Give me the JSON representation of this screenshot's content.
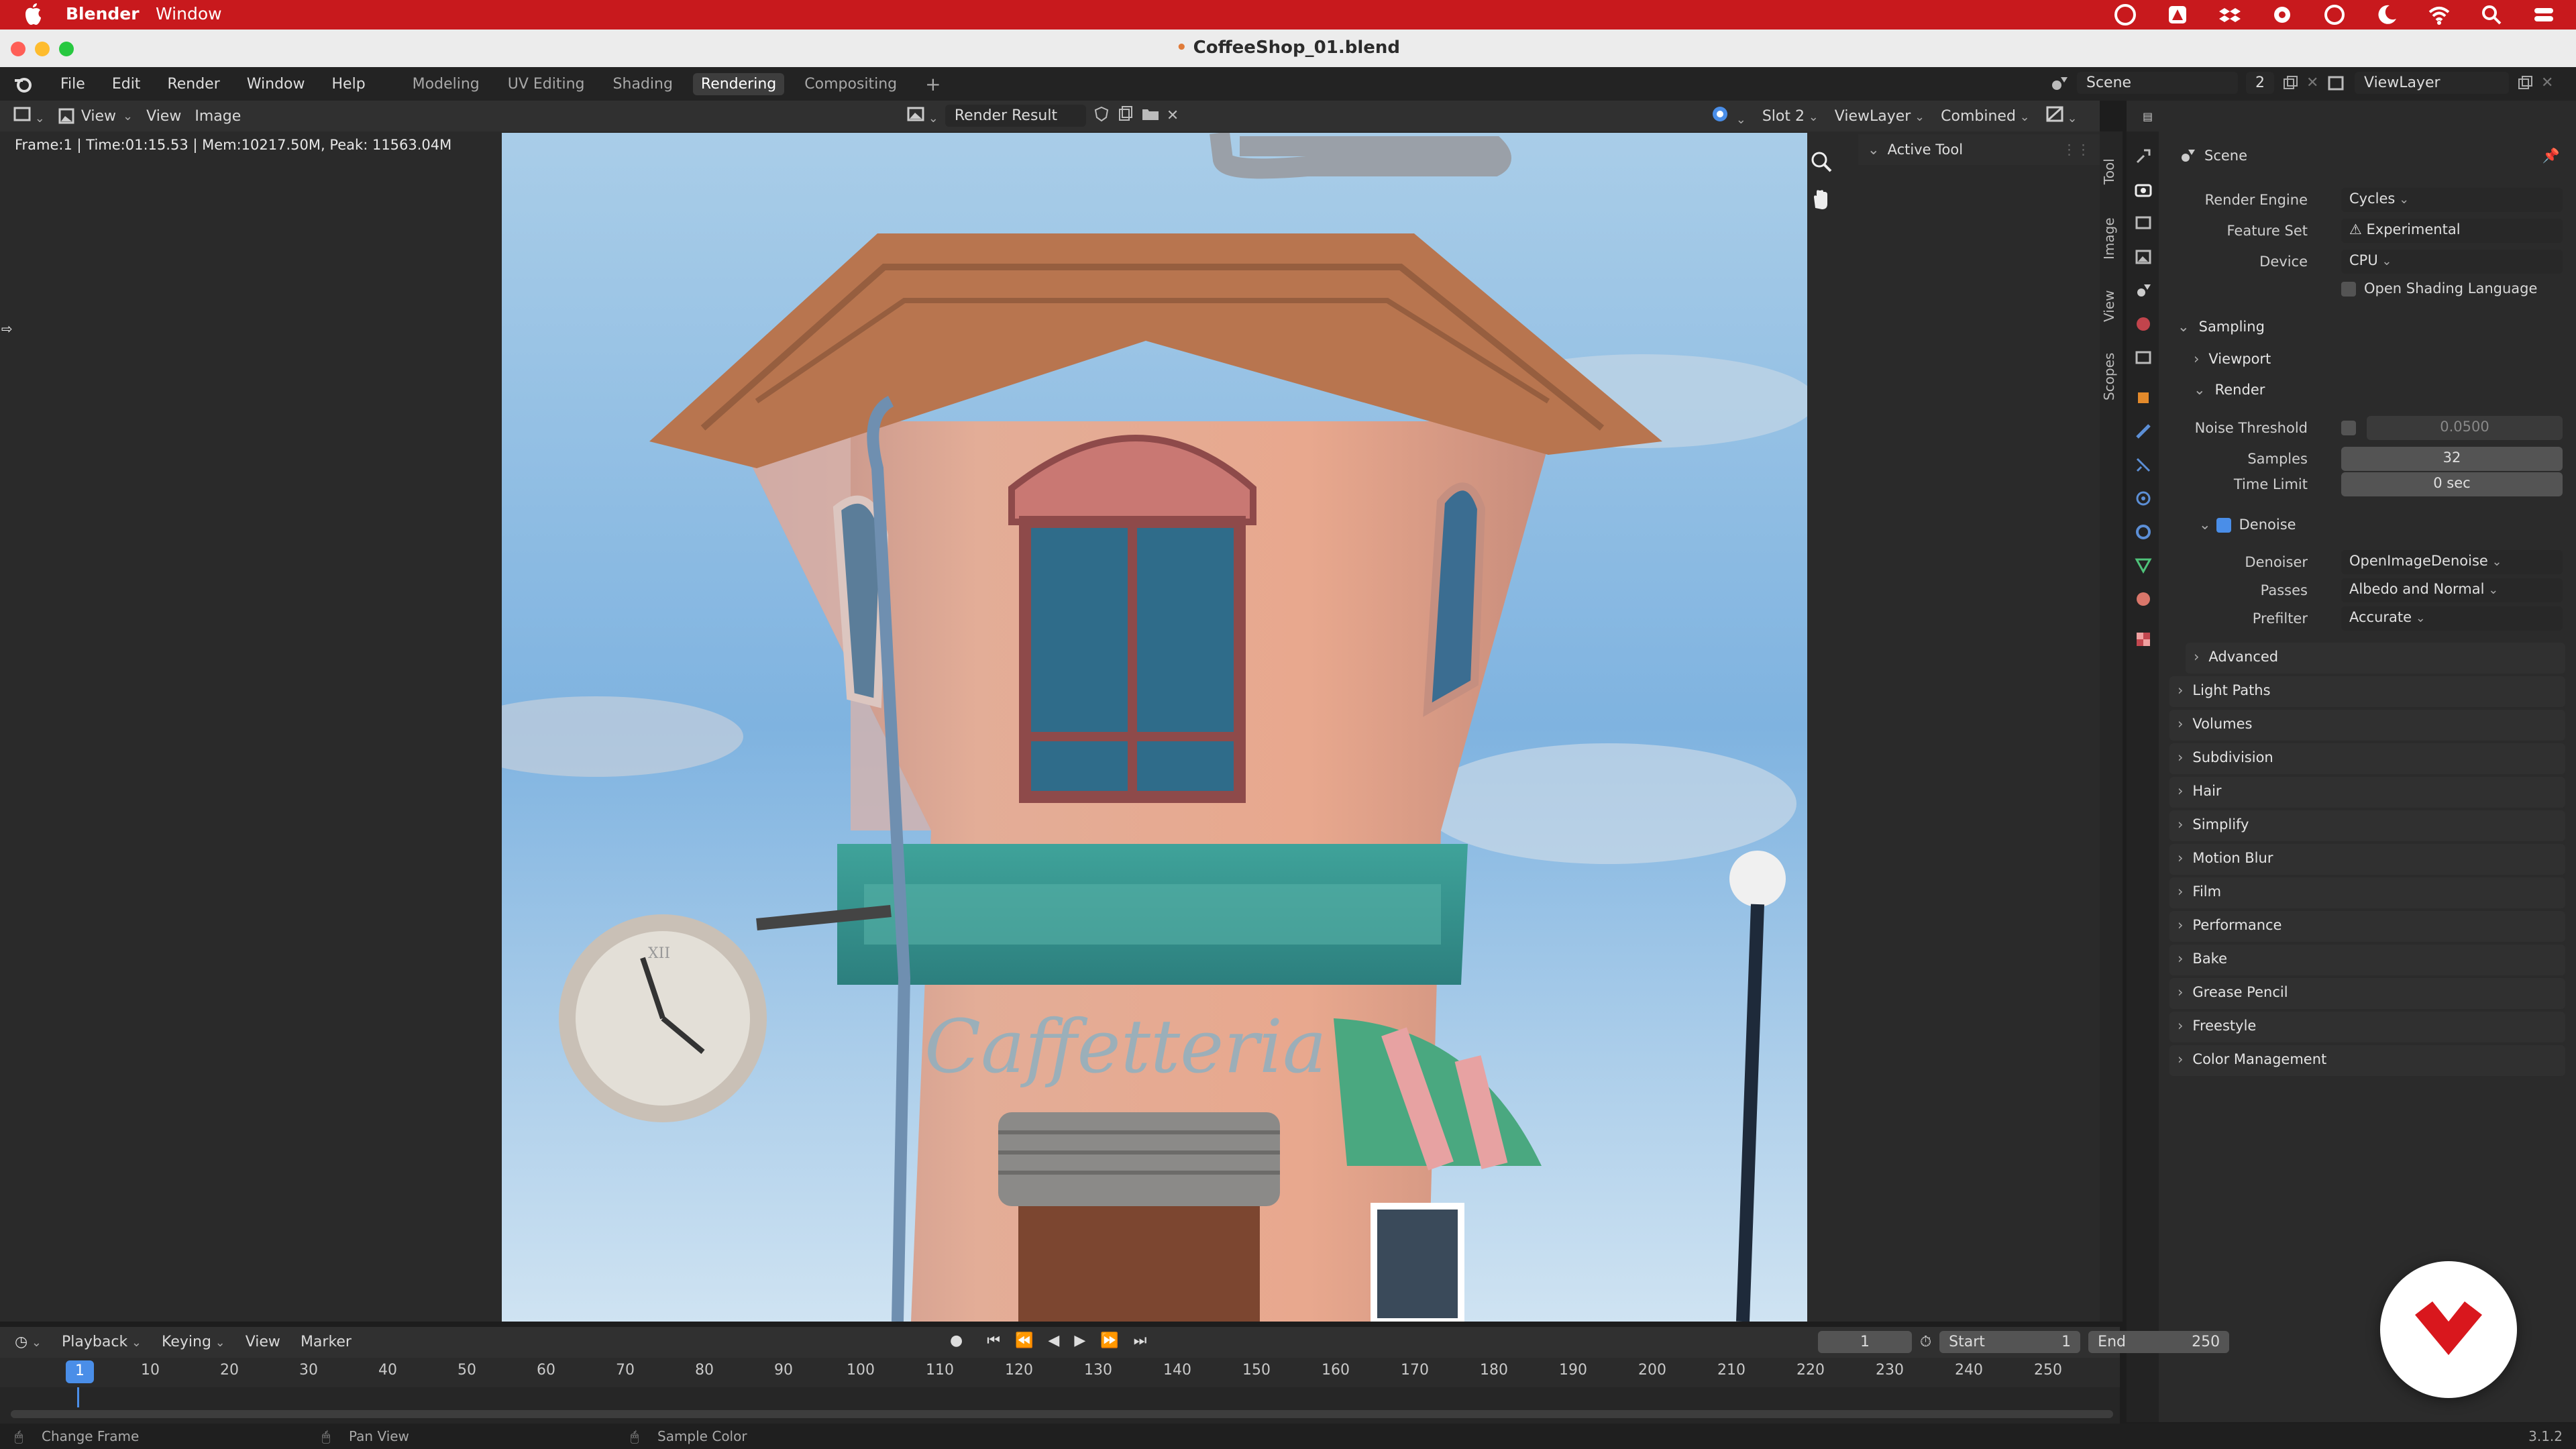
{
  "macos": {
    "app_name": "Blender",
    "menu": [
      "Window"
    ]
  },
  "window": {
    "title": "CoffeeShop_01.blend",
    "modified_dot": "•"
  },
  "blender_menu": [
    "File",
    "Edit",
    "Render",
    "Window",
    "Help"
  ],
  "workspaces": [
    {
      "label": "Modeling",
      "active": false
    },
    {
      "label": "UV Editing",
      "active": false
    },
    {
      "label": "Shading",
      "active": false
    },
    {
      "label": "Rendering",
      "active": true
    },
    {
      "label": "Compositing",
      "active": false
    }
  ],
  "add_workspace": "+",
  "scene": {
    "label": "Scene",
    "users": "2",
    "view_layer": "ViewLayer"
  },
  "image_editor": {
    "menus": [
      "View",
      "View",
      "Image"
    ],
    "image_name": "Render Result",
    "slot": "Slot 2",
    "view_layer": "ViewLayer",
    "pass": "Combined",
    "stats": "Frame:1 | Time:01:15.53 | Mem:10217.50M, Peak: 11563.04M"
  },
  "side_tabs": [
    "Tool",
    "Image",
    "View",
    "Scopes"
  ],
  "active_tool": {
    "label": "Active Tool"
  },
  "properties": {
    "context": "Scene",
    "render_engine_label": "Render Engine",
    "render_engine": "Cycles",
    "feature_set_label": "Feature Set",
    "feature_set": "Experimental",
    "device_label": "Device",
    "device": "CPU",
    "osl_label": "Open Shading Language",
    "sampling": "Sampling",
    "viewport": "Viewport",
    "render": "Render",
    "noise_threshold_label": "Noise Threshold",
    "noise_threshold": "0.0500",
    "samples_label": "Samples",
    "samples": "32",
    "time_limit_label": "Time Limit",
    "time_limit": "0 sec",
    "denoise_label": "Denoise",
    "denoiser_label": "Denoiser",
    "denoiser": "OpenImageDenoise",
    "passes_label": "Passes",
    "passes": "Albedo and Normal",
    "prefilter_label": "Prefilter",
    "prefilter": "Accurate",
    "advanced": "Advanced",
    "panels": [
      "Light Paths",
      "Volumes",
      "Subdivision",
      "Hair",
      "Simplify",
      "Motion Blur",
      "Film",
      "Performance",
      "Bake",
      "Grease Pencil",
      "Freestyle",
      "Color Management"
    ]
  },
  "timeline": {
    "menus": [
      "Playback",
      "Keying",
      "View",
      "Marker"
    ],
    "current_frame": "1",
    "start_label": "Start",
    "start": "1",
    "end_label": "End",
    "end": "250",
    "ticks": [
      "10",
      "20",
      "30",
      "40",
      "50",
      "60",
      "70",
      "80",
      "90",
      "100",
      "110",
      "120",
      "130",
      "140",
      "150",
      "160",
      "170",
      "180",
      "190",
      "200",
      "210",
      "220",
      "230",
      "240",
      "250"
    ],
    "playhead": "1"
  },
  "status": {
    "left": "Change Frame",
    "mid": "Pan View",
    "right": "Sample Color",
    "version": "3.1.2"
  },
  "render_image": {
    "sign_text": "Caffetteria",
    "clock_numeral": "XII"
  },
  "colors": {
    "mac_red": "#c8191d",
    "blender_blue": "#4a8ee8",
    "brand_red": "#d9171d"
  }
}
